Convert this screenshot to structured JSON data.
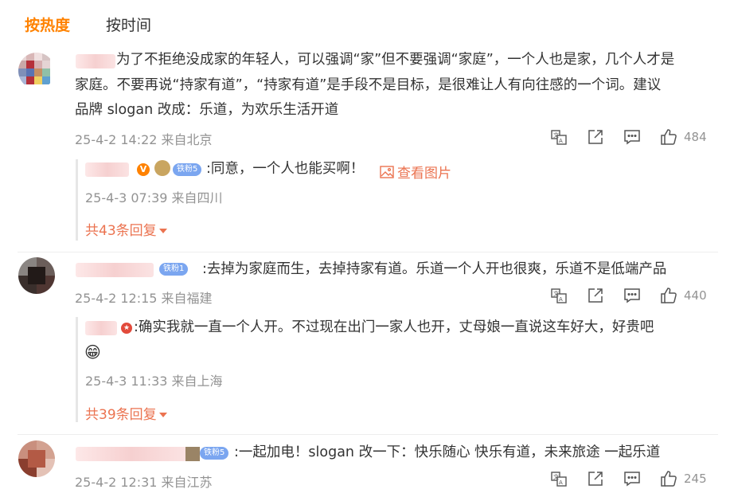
{
  "tabs": {
    "hot": "按热度",
    "time": "按时间"
  },
  "comments": [
    {
      "text_lines": [
        "为了不拒绝没成家的年轻人，可以强调“家”但不要强调“家庭”，一个人也是家，几个人才是",
        "家庭。不要再说“持家有道”，“持家有道”是手段不是目标，是很难让人有向往感的一个词。建议",
        "品牌 slogan 改成：乐道，为欢乐生活开道"
      ],
      "meta": "25-4-2 14:22 来自北京",
      "likes": "484",
      "reply": {
        "badge": "铁粉5",
        "text": ":同意，一个人也能买啊！",
        "view_image": "查看图片",
        "meta": "25-4-3 07:39 来自四川"
      },
      "more_replies": "共43条回复"
    },
    {
      "badge": "铁粉1",
      "text": ":去掉为家庭而生，去掉持家有道。乐道一个人开也很爽，乐道不是低端产品",
      "meta": "25-4-2 12:15 来自福建",
      "likes": "440",
      "reply": {
        "text": ":确实我就一直一个人开。不过现在出门一家人也开，丈母娘一直说这车好大，好贵吧",
        "emoji": "😁",
        "meta": "25-4-3 11:33 来自上海"
      },
      "more_replies": "共39条回复"
    },
    {
      "badge": "铁粉5",
      "text": ":一起加电！slogan 改一下：快乐随心 快乐有道，未来旅途 一起乐道",
      "meta": "25-4-2 12:31 来自江苏",
      "likes": "245"
    }
  ],
  "icons": [
    "translate-icon",
    "share-icon",
    "comment-icon",
    "like-icon"
  ],
  "colors": {
    "accent": "#ff8200",
    "link": "#eb7350",
    "meta": "#939393"
  }
}
